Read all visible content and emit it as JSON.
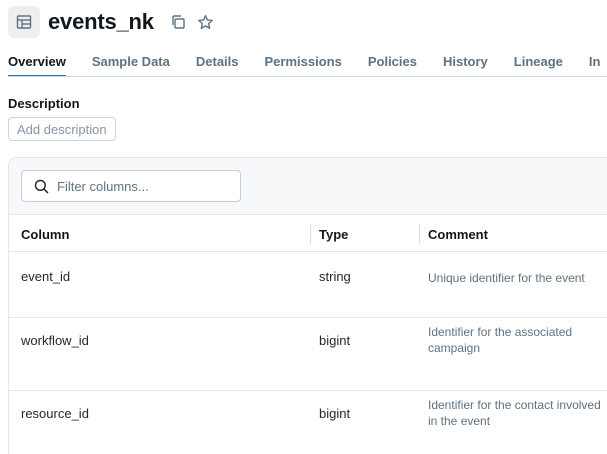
{
  "header": {
    "title": "events_nk",
    "icons": [
      "table-icon",
      "copy-icon",
      "star-icon"
    ]
  },
  "tabs": [
    {
      "label": "Overview",
      "active": true
    },
    {
      "label": "Sample Data"
    },
    {
      "label": "Details"
    },
    {
      "label": "Permissions"
    },
    {
      "label": "Policies"
    },
    {
      "label": "History"
    },
    {
      "label": "Lineage"
    },
    {
      "label": "In"
    }
  ],
  "description": {
    "label": "Description",
    "add_label": "Add description"
  },
  "filter": {
    "placeholder": "Filter columns...",
    "value": ""
  },
  "columns_table": {
    "headers": [
      "Column",
      "Type",
      "Comment"
    ],
    "rows": [
      {
        "column": "event_id",
        "type": "string",
        "comment": "Unique identifier for the event"
      },
      {
        "column": "workflow_id",
        "type": "bigint",
        "comment": "Identifier for the associated campaign"
      },
      {
        "column": "resource_id",
        "type": "bigint",
        "comment": "Identifier for the contact involved in the event"
      }
    ]
  },
  "colors": {
    "accent": "#2272b4",
    "text_primary": "#11171c",
    "text_secondary": "#5f7281"
  }
}
